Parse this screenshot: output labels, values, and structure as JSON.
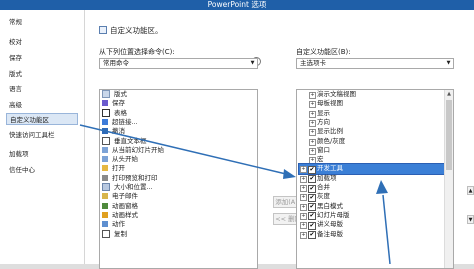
{
  "window": {
    "title": "PowerPoint 选项"
  },
  "nav": {
    "items": [
      "常规",
      "校对",
      "保存",
      "版式",
      "语言",
      "高级",
      "自定义功能区",
      "快速访问工具栏",
      "加载项",
      "信任中心"
    ],
    "selected_index": 6
  },
  "header": {
    "title": "自定义功能区。"
  },
  "left_panel": {
    "label": "从下列位置选择命令(C):",
    "info_icon": "i",
    "combo_value": "常用命令",
    "commands": [
      "版式",
      "保存",
      "表格",
      "超链接...",
      "撤消",
      "垂直文本框",
      "从当前幻灯片开始",
      "从头开始",
      "打开",
      "打印预览和打印",
      "大小和位置...",
      "电子邮件",
      "动画窗格",
      "动画样式",
      "动作",
      "复制"
    ]
  },
  "buttons": {
    "add": "添加(A) >>",
    "remove": "<< 删除(R)"
  },
  "right_panel": {
    "label": "自定义功能区(B):",
    "combo_value": "主选项卡",
    "tree": [
      {
        "label": "演示文稿视图",
        "kind": "sub"
      },
      {
        "label": "母板视图",
        "kind": "sub"
      },
      {
        "label": "显示",
        "kind": "sub"
      },
      {
        "label": "方向",
        "kind": "sub"
      },
      {
        "label": "显示比例",
        "kind": "sub"
      },
      {
        "label": "颜色/灰度",
        "kind": "sub"
      },
      {
        "label": "窗口",
        "kind": "sub"
      },
      {
        "label": "宏",
        "kind": "sub"
      },
      {
        "label": "开发工具",
        "kind": "tab",
        "selected": true
      },
      {
        "label": "加载项",
        "kind": "tab"
      },
      {
        "label": "合并",
        "kind": "tab"
      },
      {
        "label": "灰度",
        "kind": "tab"
      },
      {
        "label": "黑白模式",
        "kind": "tab"
      },
      {
        "label": "幻灯片母版",
        "kind": "tab"
      },
      {
        "label": "讲义母版",
        "kind": "tab"
      },
      {
        "label": "备注母版",
        "kind": "tab"
      }
    ]
  },
  "icons": {
    "expand": "+",
    "checkmark": "✔",
    "scroll_up": "▲",
    "scroll_down": "▼",
    "dropdown": "▼"
  },
  "colors": {
    "selection": "#3b7fd6",
    "annotation": "#2f6fb6",
    "titlebar": "#1f5fa8"
  }
}
